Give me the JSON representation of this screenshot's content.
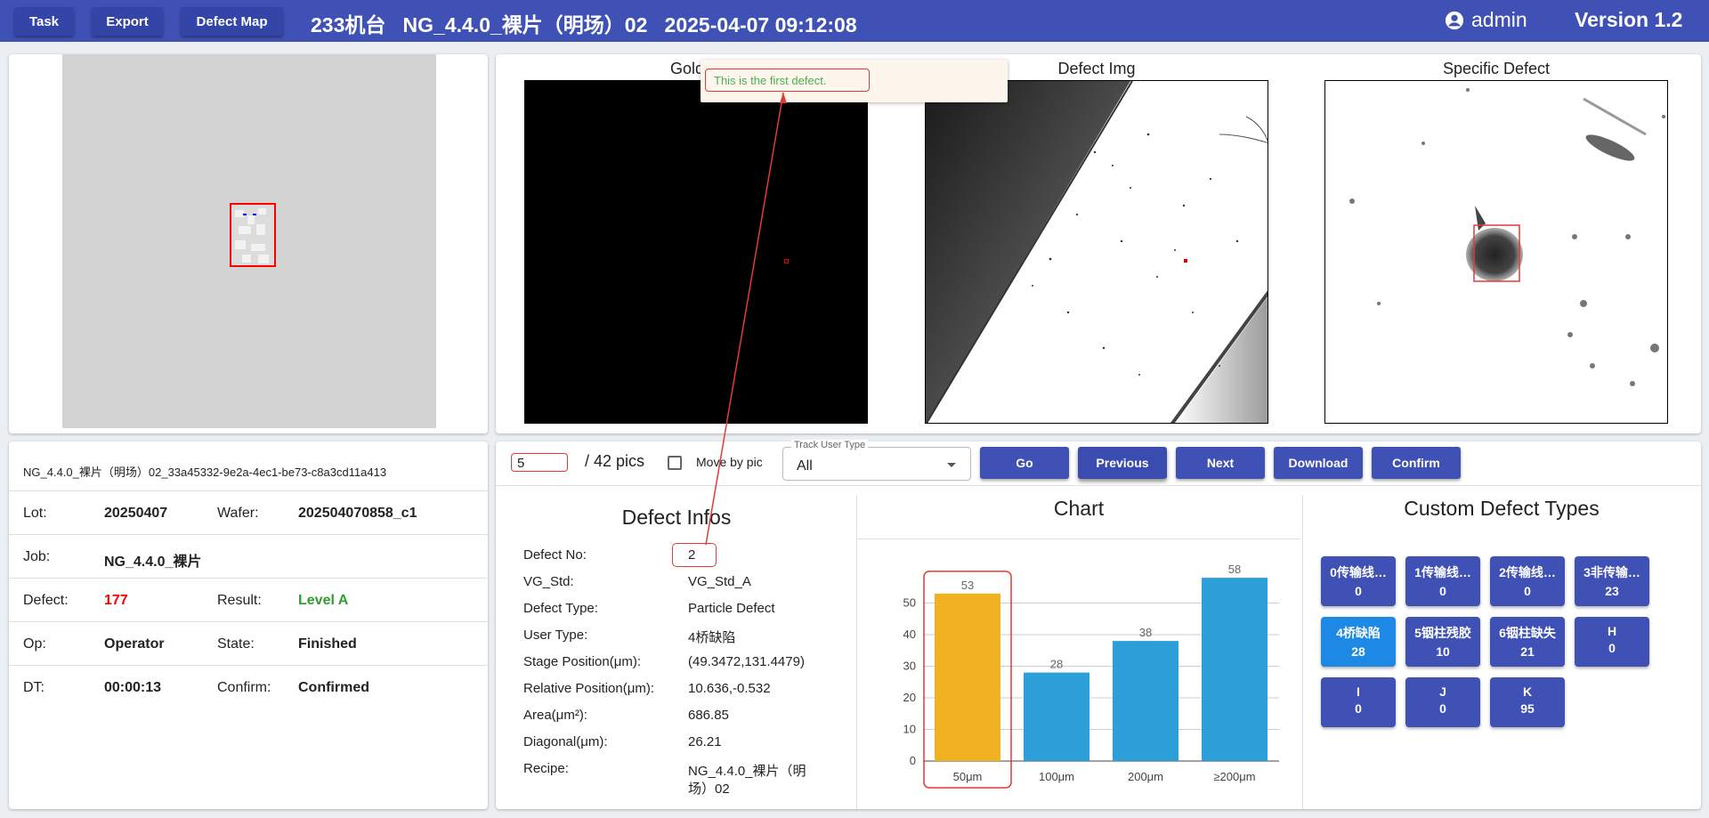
{
  "topbar": {
    "task_label": "Task",
    "export_label": "Export",
    "defect_map_label": "Defect Map",
    "title": "233机台   NG_4.4.0_裸片（明场）02   2025-04-07 09:12:08",
    "user": "admin",
    "version": "Version 1.2"
  },
  "images": {
    "golden_label": "Golden",
    "defect_label": "Defect Img",
    "specific_label": "Specific Defect",
    "tooltip": "This is the first defect."
  },
  "info": {
    "wafer_name": "NG_4.4.0_裸片（明场）02_33a45332-9e2a-4ec1-be73-c8a3cd11a413",
    "lot_label": "Lot:",
    "lot": "20250407",
    "wafer_label": "Wafer:",
    "wafer": "202504070858_c1",
    "job_label": "Job:",
    "job": "NG_4.4.0_裸片",
    "defect_label": "Defect:",
    "defect": "177",
    "result_label": "Result:",
    "result": "Level A",
    "op_label": "Op:",
    "op": "Operator",
    "state_label": "State:",
    "state": "Finished",
    "dt_label": "DT:",
    "dt": "00:00:13",
    "confirm_label": "Confirm:",
    "confirm": "Confirmed"
  },
  "nav": {
    "page_value": "5",
    "page_total": "/ 42 pics",
    "move_by_pic": "Move by pic",
    "track_legend": "Track User Type",
    "track_value": "All",
    "go": "Go",
    "previous": "Previous",
    "next": "Next",
    "download": "Download",
    "confirm": "Confirm"
  },
  "defect_infos": {
    "title": "Defect Infos",
    "rows": [
      {
        "label": "Defect No:",
        "value": "2"
      },
      {
        "label": "VG_Std:",
        "value": "VG_Std_A"
      },
      {
        "label": "Defect Type:",
        "value": "Particle Defect"
      },
      {
        "label": "User Type:",
        "value": "4桥缺陷"
      },
      {
        "label": "Stage Position(μm):",
        "value": "(49.3472,131.4479)"
      },
      {
        "label": "Relative Position(μm):",
        "value": "10.636,-0.532"
      },
      {
        "label": "Area(μm²):",
        "value": "686.85"
      },
      {
        "label": "Diagonal(μm):",
        "value": "26.21"
      },
      {
        "label": "Recipe:",
        "value": "NG_4.4.0_裸片（明",
        "value2": "场）02"
      }
    ]
  },
  "chart_title": "Chart",
  "chart_data": {
    "type": "bar",
    "categories": [
      "50μm",
      "100μm",
      "200μm",
      "≥200μm"
    ],
    "values": [
      53,
      28,
      38,
      58
    ],
    "ylim": [
      0,
      60
    ],
    "yticks": [
      0,
      10,
      20,
      30,
      40,
      50
    ],
    "colors": [
      "#f0b122",
      "#2c9fd9",
      "#2c9fd9",
      "#2c9fd9"
    ],
    "grid": true
  },
  "custom_types": {
    "title": "Custom Defect Types",
    "items": [
      {
        "name": "0传输线…",
        "count": "0"
      },
      {
        "name": "1传输线…",
        "count": "0"
      },
      {
        "name": "2传输线…",
        "count": "0"
      },
      {
        "name": "3非传输…",
        "count": "23"
      },
      {
        "name": "4桥缺陷",
        "count": "28"
      },
      {
        "name": "5铟柱残胶",
        "count": "10"
      },
      {
        "name": "6铟柱缺失",
        "count": "21"
      },
      {
        "name": "H",
        "count": "0"
      },
      {
        "name": "I",
        "count": "0"
      },
      {
        "name": "J",
        "count": "0"
      },
      {
        "name": "K",
        "count": "95"
      }
    ]
  },
  "colors": {
    "topbar": "#3f51b5",
    "button": "#3f51b5",
    "active_type": "#1e88e5",
    "highlight": "#e53935",
    "defect_count": "#ff0000",
    "result": "#2e9e2e"
  }
}
